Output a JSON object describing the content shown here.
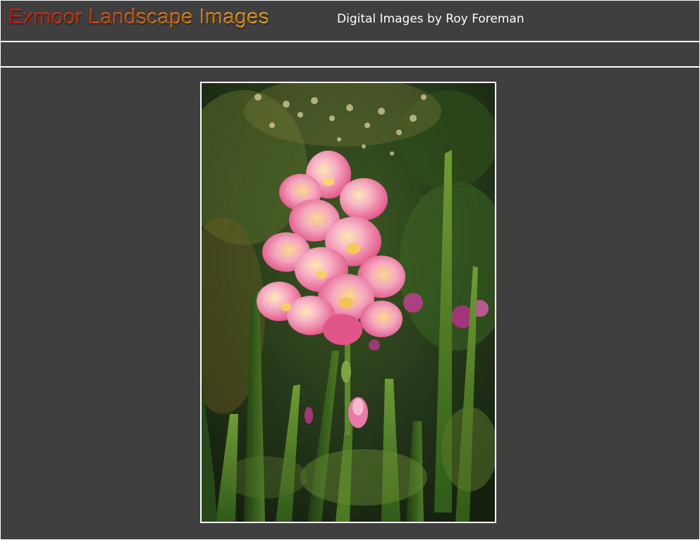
{
  "site": {
    "title": "Exmoor Landscape Images",
    "subtitle": "Digital Images by Roy Foreman"
  },
  "colors": {
    "background": "#3f3f3f",
    "rule": "#ffffff",
    "title_gradient_start": "#d11e12",
    "title_gradient_end": "#f6b21a",
    "subtitle": "#ffffff"
  },
  "photo": {
    "subject": "pink gladiolus flower spike with green leaves"
  }
}
